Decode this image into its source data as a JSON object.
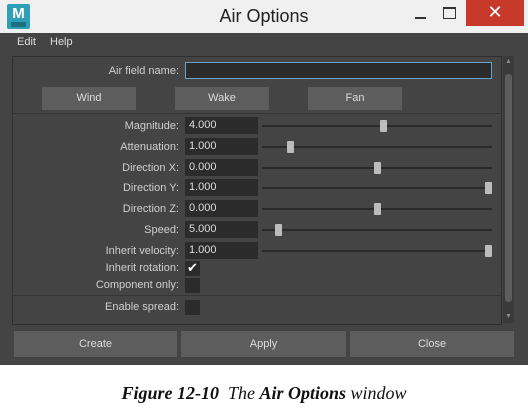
{
  "window": {
    "title": "Air Options",
    "close_glyph": "✕"
  },
  "menubar": {
    "items": [
      "Edit",
      "Help"
    ]
  },
  "form": {
    "air_field_name": {
      "label": "Air field name:",
      "value": ""
    },
    "tabs": [
      "Wind",
      "Wake",
      "Fan"
    ],
    "sliders": [
      {
        "label": "Magnitude:",
        "value": "4.000",
        "slider_fraction": 0.53
      },
      {
        "label": "Attenuation:",
        "value": "1.000",
        "slider_fraction": 0.11
      },
      {
        "label": "Direction X:",
        "value": "0.000",
        "slider_fraction": 0.5
      },
      {
        "label": "Direction Y:",
        "value": "1.000",
        "slider_fraction": 1.0
      },
      {
        "label": "Direction Z:",
        "value": "0.000",
        "slider_fraction": 0.5
      },
      {
        "label": "Speed:",
        "value": "5.000",
        "slider_fraction": 0.06
      },
      {
        "label": "Inherit velocity:",
        "value": "1.000",
        "slider_fraction": 1.0
      }
    ],
    "checkboxes": [
      {
        "label": "Inherit rotation:",
        "checked": true,
        "glyph": "✔"
      },
      {
        "label": "Component only:",
        "checked": false,
        "glyph": ""
      },
      {
        "label": "Enable spread:",
        "checked": false,
        "glyph": ""
      }
    ]
  },
  "buttons": {
    "create": "Create",
    "apply": "Apply",
    "close": "Close"
  },
  "caption": {
    "figure": "Figure 12-10",
    "pre": "The",
    "bold": "Air Options",
    "post": "window"
  }
}
